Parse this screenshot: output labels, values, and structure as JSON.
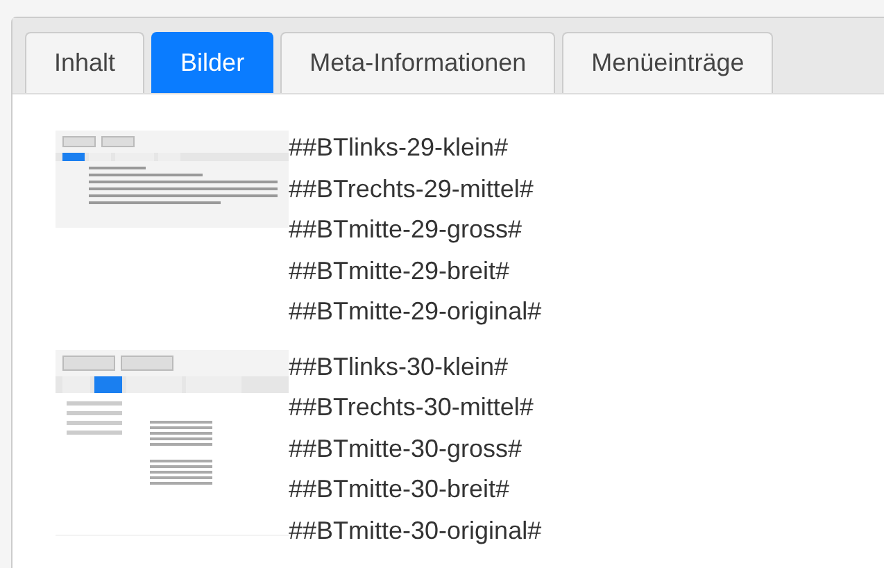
{
  "tabs": [
    {
      "label": "Inhalt",
      "selected": false
    },
    {
      "label": "Bilder",
      "selected": true
    },
    {
      "label": "Meta-Informationen",
      "selected": false
    },
    {
      "label": "Menüeinträge",
      "selected": false
    }
  ],
  "images": [
    {
      "kind": "form",
      "codes": [
        "##BTlinks-29-klein#",
        "##BTrechts-29-mittel#",
        "##BTmitte-29-gross#",
        "##BTmitte-29-breit#",
        "##BTmitte-29-original#"
      ]
    },
    {
      "kind": "tabs",
      "codes": [
        "##BTlinks-30-klein#",
        "##BTrechts-30-mittel#",
        "##BTmitte-30-gross#",
        "##BTmitte-30-breit#",
        "##BTmitte-30-original#"
      ]
    }
  ]
}
